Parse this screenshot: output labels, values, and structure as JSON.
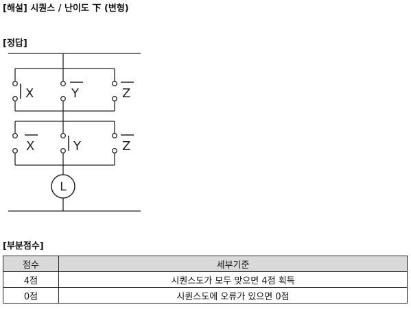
{
  "headings": {
    "title": "[해설] 시퀀스 / 난이도 下 (변형)",
    "answer": "[정답]",
    "partial_score": "[부분점수]"
  },
  "diagram": {
    "group1": {
      "left_label": "X",
      "center_label": "Y",
      "center_overbar": true,
      "right_label": "Z",
      "right_overbar": true
    },
    "group2": {
      "left_label": "X",
      "left_overbar": true,
      "center_label": "Y",
      "right_label": "Z",
      "right_overbar": true
    },
    "lamp_label": "L"
  },
  "table": {
    "headers": [
      "점수",
      "세부기준"
    ],
    "rows": [
      [
        "4점",
        "시퀀스도가 모두 맞으면 4점 획득"
      ],
      [
        "0점",
        "시퀀스도에 오류가 있으면 0점"
      ]
    ]
  }
}
